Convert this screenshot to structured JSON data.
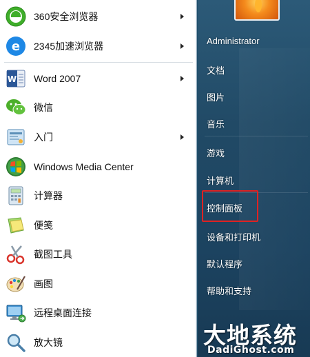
{
  "programs": [
    {
      "label": "360安全浏览器",
      "icon": "browser-360-icon",
      "has_submenu": true
    },
    {
      "label": "2345加速浏览器",
      "icon": "browser-2345-icon",
      "has_submenu": true
    },
    {
      "label": "Word 2007",
      "icon": "word-icon",
      "has_submenu": true
    },
    {
      "label": "微信",
      "icon": "wechat-icon",
      "has_submenu": false
    },
    {
      "label": "入门",
      "icon": "getting-started-icon",
      "has_submenu": true
    },
    {
      "label": "Windows Media Center",
      "icon": "media-center-icon",
      "has_submenu": false
    },
    {
      "label": "计算器",
      "icon": "calculator-icon",
      "has_submenu": false
    },
    {
      "label": "便笺",
      "icon": "sticky-notes-icon",
      "has_submenu": false
    },
    {
      "label": "截图工具",
      "icon": "snipping-tool-icon",
      "has_submenu": false
    },
    {
      "label": "画图",
      "icon": "paint-icon",
      "has_submenu": false
    },
    {
      "label": "远程桌面连接",
      "icon": "remote-desktop-icon",
      "has_submenu": false
    },
    {
      "label": "放大镜",
      "icon": "magnifier-icon",
      "has_submenu": false
    }
  ],
  "right_pane": {
    "user_name": "Administrator",
    "links": [
      {
        "label": "文档"
      },
      {
        "label": "图片"
      },
      {
        "label": "音乐"
      },
      {
        "label": "游戏"
      },
      {
        "label": "计算机"
      },
      {
        "label": "控制面板",
        "highlighted": true
      },
      {
        "label": "设备和打印机"
      },
      {
        "label": "默认程序"
      },
      {
        "label": "帮助和支持"
      }
    ]
  },
  "watermark": {
    "title": "大地系统",
    "url": "DadiGhost.com"
  },
  "colors": {
    "highlight_border": "#e02222",
    "right_pane_bg": "#214a66",
    "left_pane_bg": "#ffffff"
  }
}
